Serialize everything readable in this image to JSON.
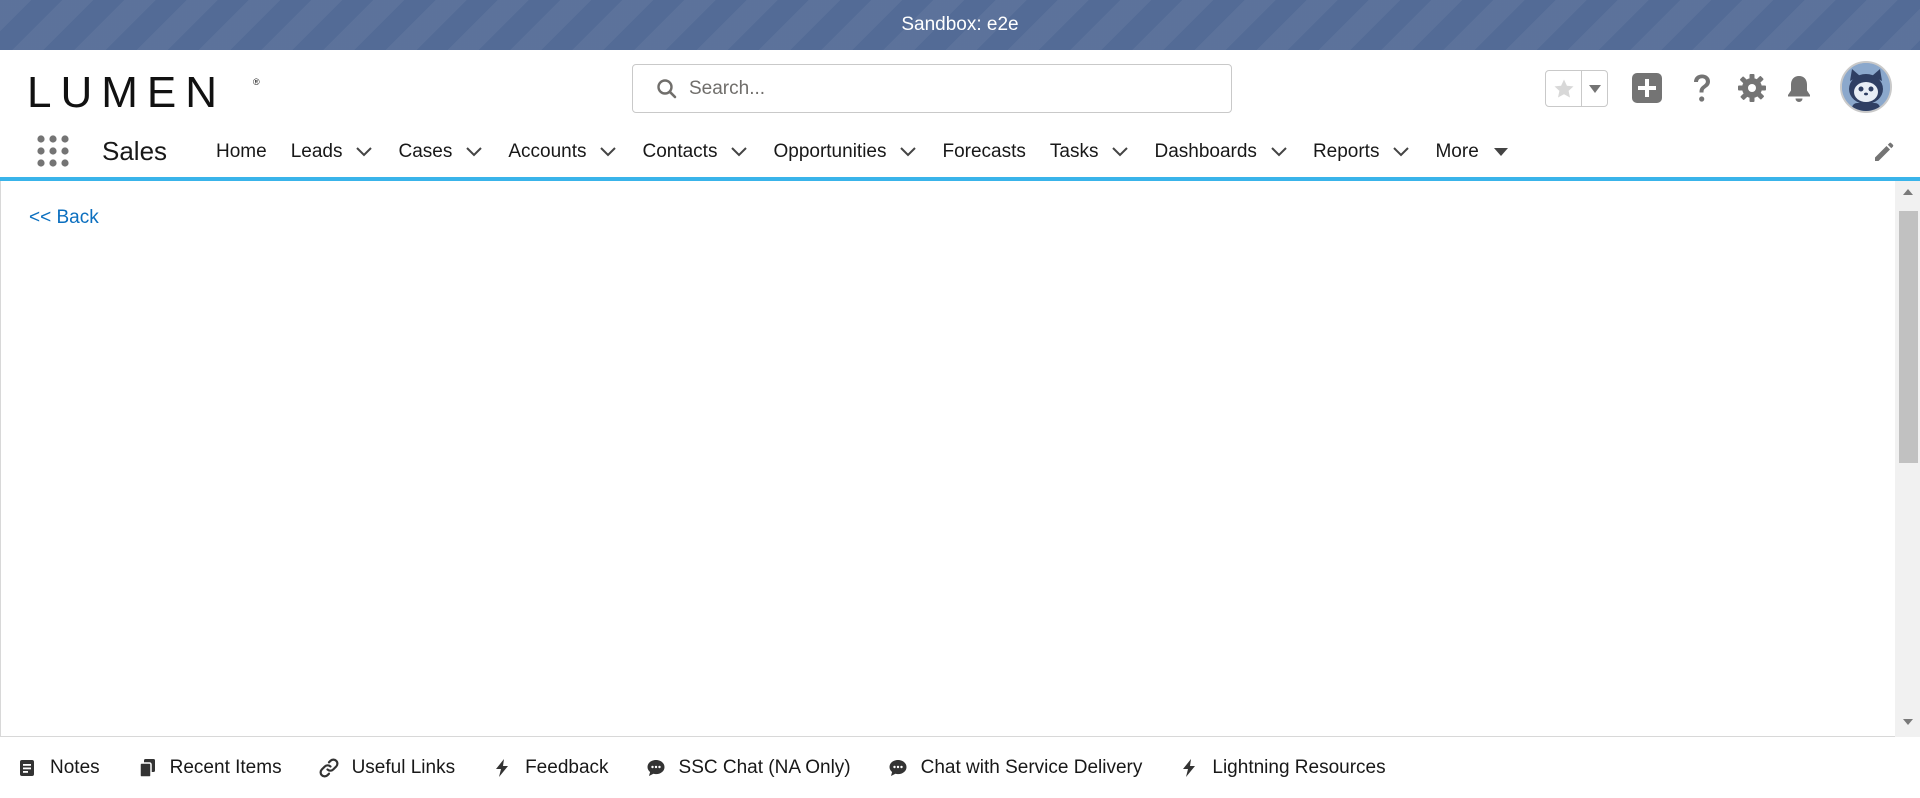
{
  "sandbox": {
    "label": "Sandbox: e2e"
  },
  "header": {
    "logo_text": "LUMEN",
    "search_placeholder": "Search...",
    "icons": [
      "star-icon",
      "chevron-down-icon",
      "add-icon",
      "help-icon",
      "setup-gear-icon",
      "notification-bell-icon",
      "avatar"
    ]
  },
  "nav": {
    "app_name": "Sales",
    "items": [
      {
        "label": "Home",
        "has_menu": false
      },
      {
        "label": "Leads",
        "has_menu": true
      },
      {
        "label": "Cases",
        "has_menu": true
      },
      {
        "label": "Accounts",
        "has_menu": true
      },
      {
        "label": "Contacts",
        "has_menu": true
      },
      {
        "label": "Opportunities",
        "has_menu": true
      },
      {
        "label": "Forecasts",
        "has_menu": false
      },
      {
        "label": "Tasks",
        "has_menu": true
      },
      {
        "label": "Dashboards",
        "has_menu": true
      },
      {
        "label": "Reports",
        "has_menu": true
      },
      {
        "label": "More",
        "has_menu": true
      }
    ]
  },
  "content": {
    "back_label": "<< Back"
  },
  "utility": {
    "items": [
      {
        "label": "Notes",
        "icon": "notes-icon"
      },
      {
        "label": "Recent Items",
        "icon": "recent-items-icon"
      },
      {
        "label": "Useful Links",
        "icon": "link-icon"
      },
      {
        "label": "Feedback",
        "icon": "lightning-icon"
      },
      {
        "label": "SSC Chat (NA Only)",
        "icon": "chat-icon"
      },
      {
        "label": "Chat with Service Delivery",
        "icon": "chat-icon"
      },
      {
        "label": "Lightning Resources",
        "icon": "lightning-icon"
      }
    ]
  },
  "colors": {
    "sandbox_bg": "#536b96",
    "nav_accent": "#39b4ea",
    "link": "#0b6fbf",
    "icon_gray": "#747474"
  }
}
